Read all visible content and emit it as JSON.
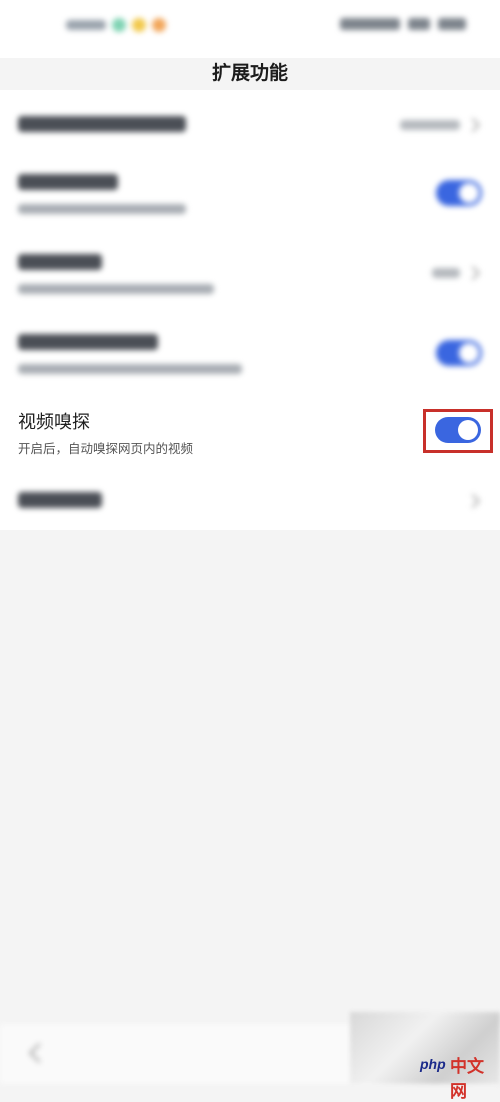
{
  "header": {
    "title": "扩展功能"
  },
  "status_bar": {
    "colors": [
      "#7fd3b3",
      "#f2c94c",
      "#f2a65a"
    ]
  },
  "settings": {
    "video_sniff": {
      "title": "视频嗅探",
      "subtitle": "开启后，自动嗅探网页内的视频",
      "enabled": true
    }
  },
  "colors": {
    "accent": "#3a66e0",
    "highlight": "#c8302a"
  },
  "watermark": {
    "php": "php",
    "cn": "中文网"
  }
}
